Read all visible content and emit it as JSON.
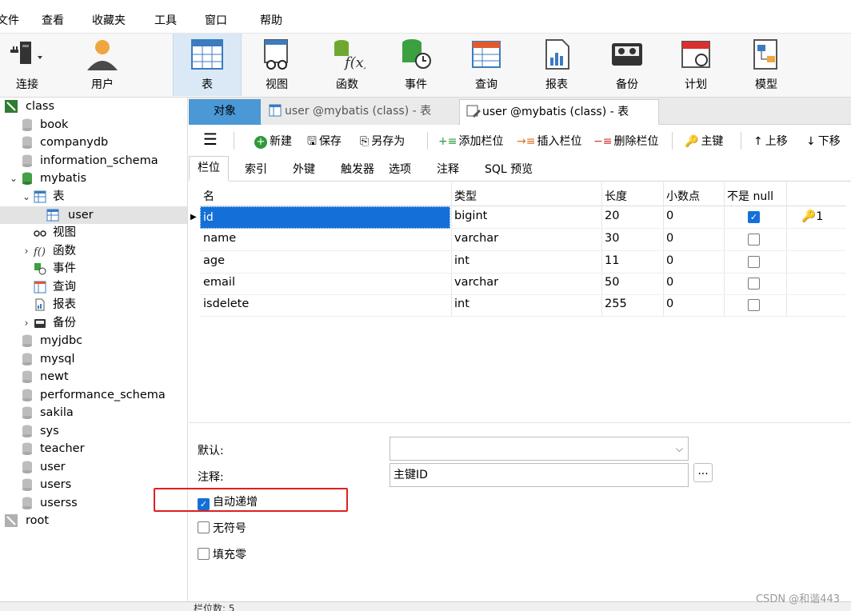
{
  "menu": [
    "文件",
    "查看",
    "收藏夹",
    "工具",
    "窗口",
    "帮助"
  ],
  "toolbar": {
    "items": [
      {
        "label": "连接",
        "icon": "connection-icon"
      },
      {
        "label": "用户",
        "icon": "user-icon"
      },
      {
        "label": "表",
        "icon": "table-icon"
      },
      {
        "label": "视图",
        "icon": "view-icon"
      },
      {
        "label": "函数",
        "icon": "function-icon"
      },
      {
        "label": "事件",
        "icon": "event-icon"
      },
      {
        "label": "查询",
        "icon": "query-icon"
      },
      {
        "label": "报表",
        "icon": "report-icon"
      },
      {
        "label": "备份",
        "icon": "backup-icon"
      },
      {
        "label": "计划",
        "icon": "schedule-icon"
      },
      {
        "label": "模型",
        "icon": "model-icon"
      }
    ]
  },
  "tree": {
    "class": "class",
    "dbs_top": [
      "book",
      "companydb",
      "information_schema"
    ],
    "mybatis": "mybatis",
    "tables": "表",
    "user_table": "user",
    "views": "视图",
    "functions": "函数",
    "events": "事件",
    "queries": "查询",
    "reports": "报表",
    "backups": "备份",
    "dbs_bottom": [
      "myjdbc",
      "mysql",
      "newt",
      "performance_schema",
      "sakila",
      "sys",
      "teacher",
      "user",
      "users",
      "userss"
    ],
    "root": "root"
  },
  "tabs": {
    "objects": "对象",
    "tab1": "user @mybatis (class) - 表",
    "tab2": "user @mybatis (class) - 表"
  },
  "actions": {
    "new": "新建",
    "save": "保存",
    "save_as": "另存为",
    "add_field": "添加栏位",
    "insert_field": "插入栏位",
    "delete_field": "删除栏位",
    "primary_key": "主键",
    "move_up": "上移",
    "move_down": "下移"
  },
  "subtabs": [
    "栏位",
    "索引",
    "外键",
    "触发器",
    "选项",
    "注释",
    "SQL 预览"
  ],
  "grid": {
    "headers": [
      "名",
      "类型",
      "长度",
      "小数点",
      "不是 null"
    ],
    "rows": [
      {
        "name": "id",
        "type": "bigint",
        "length": "20",
        "decimals": "0",
        "not_null": true,
        "key": "1"
      },
      {
        "name": "name",
        "type": "varchar",
        "length": "30",
        "decimals": "0",
        "not_null": false,
        "key": ""
      },
      {
        "name": "age",
        "type": "int",
        "length": "11",
        "decimals": "0",
        "not_null": false,
        "key": ""
      },
      {
        "name": "email",
        "type": "varchar",
        "length": "50",
        "decimals": "0",
        "not_null": false,
        "key": ""
      },
      {
        "name": "isdelete",
        "type": "int",
        "length": "255",
        "decimals": "0",
        "not_null": false,
        "key": ""
      }
    ]
  },
  "props": {
    "default_label": "默认:",
    "default_value": "",
    "comment_label": "注释:",
    "comment_value": "主键ID",
    "auto_increment": "自动递增",
    "auto_increment_checked": true,
    "unsigned": "无符号",
    "unsigned_checked": false,
    "zerofill": "填充零",
    "zerofill_checked": false,
    "ellipsis": "..."
  },
  "status": {
    "field_count": "栏位数: 5"
  },
  "watermark": "CSDN @和谐443",
  "colors": {
    "accent": "#1470d6",
    "tab_active": "#4a98d6",
    "highlight": "#e02020"
  }
}
